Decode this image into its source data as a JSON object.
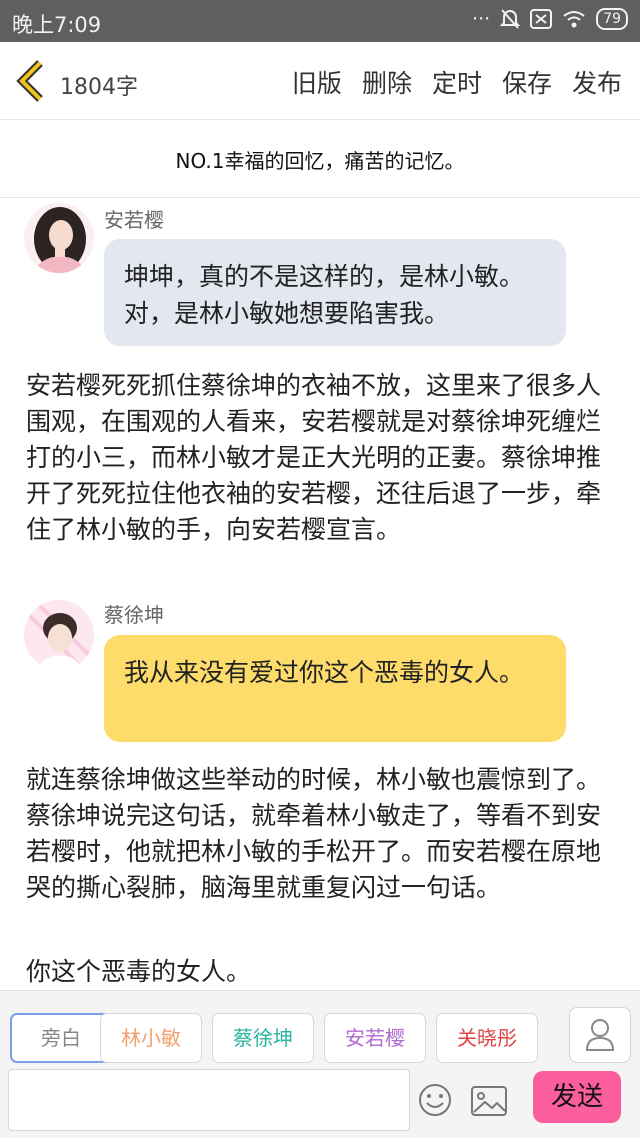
{
  "status": {
    "time": "晚上7:09",
    "battery": "79"
  },
  "header": {
    "word_count": "1804字",
    "actions": [
      "旧版",
      "删除",
      "定时",
      "保存",
      "发布"
    ]
  },
  "title": "NO.1幸福的回忆，痛苦的记忆。",
  "story": {
    "msg1": {
      "speaker": "安若樱",
      "text": "坤坤，真的不是这样的，是林小敏。对，是林小敏她想要陷害我。"
    },
    "narr1": "安若樱死死抓住蔡徐坤的衣袖不放，这里来了很多人围观，在围观的人看来，安若樱就是对蔡徐坤死缠烂打的小三，而林小敏才是正大光明的正妻。蔡徐坤推开了死死拉住他衣袖的安若樱，还往后退了一步，牵住了林小敏的手，向安若樱宣言。",
    "msg2": {
      "speaker": "蔡徐坤",
      "text": "我从来没有爱过你这个恶毒的女人。"
    },
    "narr2": "就连蔡徐坤做这些举动的时候，林小敏也震惊到了。蔡徐坤说完这句话，就牵着林小敏走了，等看不到安若樱时，他就把林小敏的手松开了。而安若樱在原地哭的撕心裂肺，脑海里就重复闪过一句话。",
    "narr3": "你这个恶毒的女人。"
  },
  "roles": [
    {
      "label": "旁白",
      "color": "#888888"
    },
    {
      "label": "林小敏",
      "color": "#f2a071"
    },
    {
      "label": "蔡徐坤",
      "color": "#2bb5a0"
    },
    {
      "label": "安若樱",
      "color": "#b06ad0"
    },
    {
      "label": "关晓彤",
      "color": "#e04545"
    }
  ],
  "composer": {
    "send_label": "发送"
  }
}
